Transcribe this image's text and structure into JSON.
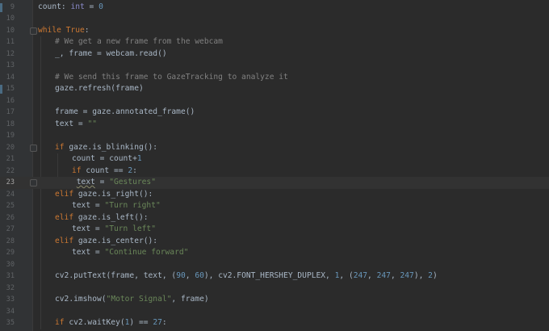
{
  "editor": {
    "lines": [
      {
        "n": "9",
        "indent": 0,
        "tokens": [
          [
            "count: ",
            "var"
          ],
          [
            "int",
            "builtin"
          ],
          [
            " = ",
            "op"
          ],
          [
            "0",
            "num"
          ]
        ]
      },
      {
        "n": "10",
        "indent": 0,
        "tokens": []
      },
      {
        "n": "10",
        "indent": 0,
        "tokens": [
          [
            "while ",
            "kw"
          ],
          [
            "True",
            "kw"
          ],
          [
            ":",
            "op"
          ]
        ]
      },
      {
        "n": "11",
        "indent": 1,
        "tokens": [
          [
            "# We get a new frame from the webcam",
            "cmt"
          ]
        ]
      },
      {
        "n": "12",
        "indent": 1,
        "tokens": [
          [
            "_, frame = webcam.read()",
            "var"
          ]
        ]
      },
      {
        "n": "13",
        "indent": 0,
        "tokens": []
      },
      {
        "n": "14",
        "indent": 1,
        "tokens": [
          [
            "# We send this frame to GazeTracking to analyze it",
            "cmt"
          ]
        ]
      },
      {
        "n": "15",
        "indent": 1,
        "tokens": [
          [
            "gaze.refresh(frame)",
            "var"
          ]
        ]
      },
      {
        "n": "16",
        "indent": 0,
        "tokens": []
      },
      {
        "n": "17",
        "indent": 1,
        "tokens": [
          [
            "frame = gaze.annotated_frame()",
            "var"
          ]
        ]
      },
      {
        "n": "18",
        "indent": 1,
        "tokens": [
          [
            "text = ",
            "var"
          ],
          [
            "\"\"",
            "str"
          ]
        ]
      },
      {
        "n": "19",
        "indent": 0,
        "tokens": []
      },
      {
        "n": "20",
        "indent": 1,
        "tokens": [
          [
            "if ",
            "kw"
          ],
          [
            "gaze.is_blinking():",
            "var"
          ]
        ]
      },
      {
        "n": "21",
        "indent": 2,
        "tokens": [
          [
            "count = count+",
            "var"
          ],
          [
            "1",
            "num"
          ]
        ]
      },
      {
        "n": "22",
        "indent": 2,
        "tokens": [
          [
            "if ",
            "kw"
          ],
          [
            "count == ",
            "var"
          ],
          [
            "2",
            "num"
          ],
          [
            ":",
            "op"
          ]
        ]
      },
      {
        "n": "23",
        "indent": 2,
        "tokens": [
          [
            " ",
            "var"
          ],
          [
            "text",
            "warn"
          ],
          [
            " = ",
            "var"
          ],
          [
            "\"Gestures\"",
            "str"
          ]
        ],
        "current": true
      },
      {
        "n": "24",
        "indent": 1,
        "tokens": [
          [
            "elif ",
            "kw"
          ],
          [
            "gaze.is_right():",
            "var"
          ]
        ]
      },
      {
        "n": "25",
        "indent": 2,
        "tokens": [
          [
            "text = ",
            "var"
          ],
          [
            "\"Turn right\"",
            "str"
          ]
        ]
      },
      {
        "n": "26",
        "indent": 1,
        "tokens": [
          [
            "elif ",
            "kw"
          ],
          [
            "gaze.is_left():",
            "var"
          ]
        ]
      },
      {
        "n": "27",
        "indent": 2,
        "tokens": [
          [
            "text = ",
            "var"
          ],
          [
            "\"Turn left\"",
            "str"
          ]
        ]
      },
      {
        "n": "28",
        "indent": 1,
        "tokens": [
          [
            "elif ",
            "kw"
          ],
          [
            "gaze.is_center():",
            "var"
          ]
        ]
      },
      {
        "n": "29",
        "indent": 2,
        "tokens": [
          [
            "text = ",
            "var"
          ],
          [
            "\"Continue forward\"",
            "str"
          ]
        ]
      },
      {
        "n": "30",
        "indent": 0,
        "tokens": []
      },
      {
        "n": "31",
        "indent": 1,
        "tokens": [
          [
            "cv2.putText(frame, text, (",
            "var"
          ],
          [
            "90",
            "num"
          ],
          [
            ", ",
            "var"
          ],
          [
            "60",
            "num"
          ],
          [
            "), cv2.FONT_HERSHEY_DUPLEX, ",
            "var"
          ],
          [
            "1",
            "num"
          ],
          [
            ", (",
            "var"
          ],
          [
            "247",
            "num"
          ],
          [
            ", ",
            "var"
          ],
          [
            "247",
            "num"
          ],
          [
            ", ",
            "var"
          ],
          [
            "247",
            "num"
          ],
          [
            "), ",
            "var"
          ],
          [
            "2",
            "num"
          ],
          [
            ")",
            "var"
          ]
        ]
      },
      {
        "n": "32",
        "indent": 0,
        "tokens": []
      },
      {
        "n": "33",
        "indent": 1,
        "tokens": [
          [
            "cv2.imshow(",
            "var"
          ],
          [
            "\"Motor Signal\"",
            "str"
          ],
          [
            ", frame)",
            "var"
          ]
        ]
      },
      {
        "n": "34",
        "indent": 0,
        "tokens": []
      },
      {
        "n": "35",
        "indent": 1,
        "tokens": [
          [
            "if ",
            "kw"
          ],
          [
            "cv2.waitKey(",
            "var"
          ],
          [
            "1",
            "num"
          ],
          [
            ") == ",
            "var"
          ],
          [
            "27",
            "num"
          ],
          [
            ":",
            "op"
          ]
        ]
      }
    ]
  },
  "colors": {
    "background": "#2b2b2b",
    "gutter": "#313335",
    "keyword": "#cc7832",
    "number": "#6897bb",
    "string": "#6a8759",
    "comment": "#808080",
    "text": "#a9b7c6"
  }
}
